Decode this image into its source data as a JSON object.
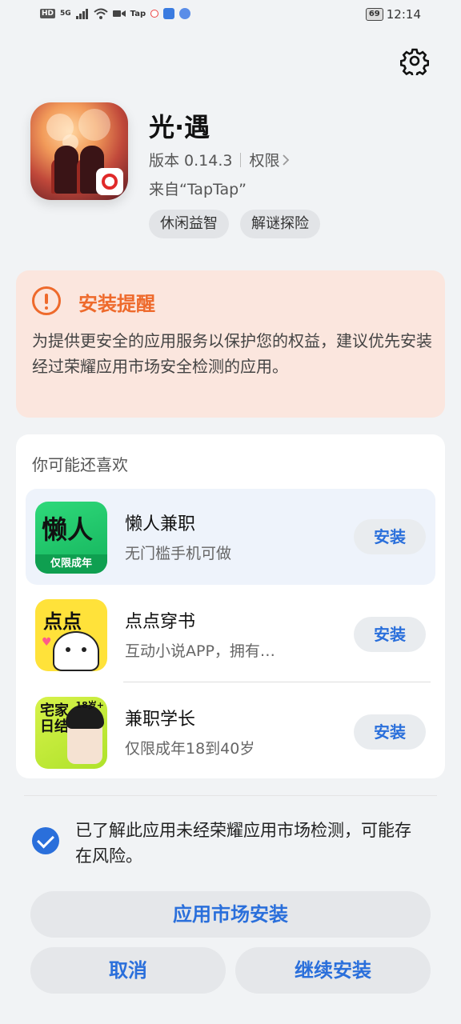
{
  "status_bar": {
    "network": "HD",
    "signal": "5G",
    "tap_label": "Tap",
    "battery": "69",
    "time": "12:14"
  },
  "app": {
    "title": "光·遇",
    "version": "版本 0.14.3",
    "permission_label": "权限",
    "source": "来自“TapTap”",
    "tags": [
      "休闲益智",
      "解谜探险"
    ]
  },
  "warning": {
    "title": "安装提醒",
    "text": "为提供更安全的应用服务以保护您的权益，建议优先安装经过荣耀应用市场安全检测的应用。"
  },
  "recommend": {
    "title": "你可能还喜欢",
    "items": [
      {
        "name": "懒人兼职",
        "desc": "无门槛手机可做",
        "button": "安装",
        "thumb_text": "懒人",
        "thumb_strip": "仅限成年"
      },
      {
        "name": "点点穿书",
        "desc": "互动小说APP，拥有…",
        "button": "安装",
        "thumb_text": "点点"
      },
      {
        "name": "兼职学长",
        "desc": "仅限成年18到40岁",
        "button": "安装",
        "thumb_text": "宅家日结",
        "thumb_age": "18岁+"
      }
    ]
  },
  "consent": {
    "checked": true,
    "text": "已了解此应用未经荣耀应用市场检测，可能存在风险。"
  },
  "buttons": {
    "market_install": "应用市场安装",
    "cancel": "取消",
    "continue_install": "继续安装"
  },
  "colors": {
    "accent": "#2a6fdb",
    "warning": "#ee6a2c",
    "warning_bg": "#fbe6de"
  }
}
